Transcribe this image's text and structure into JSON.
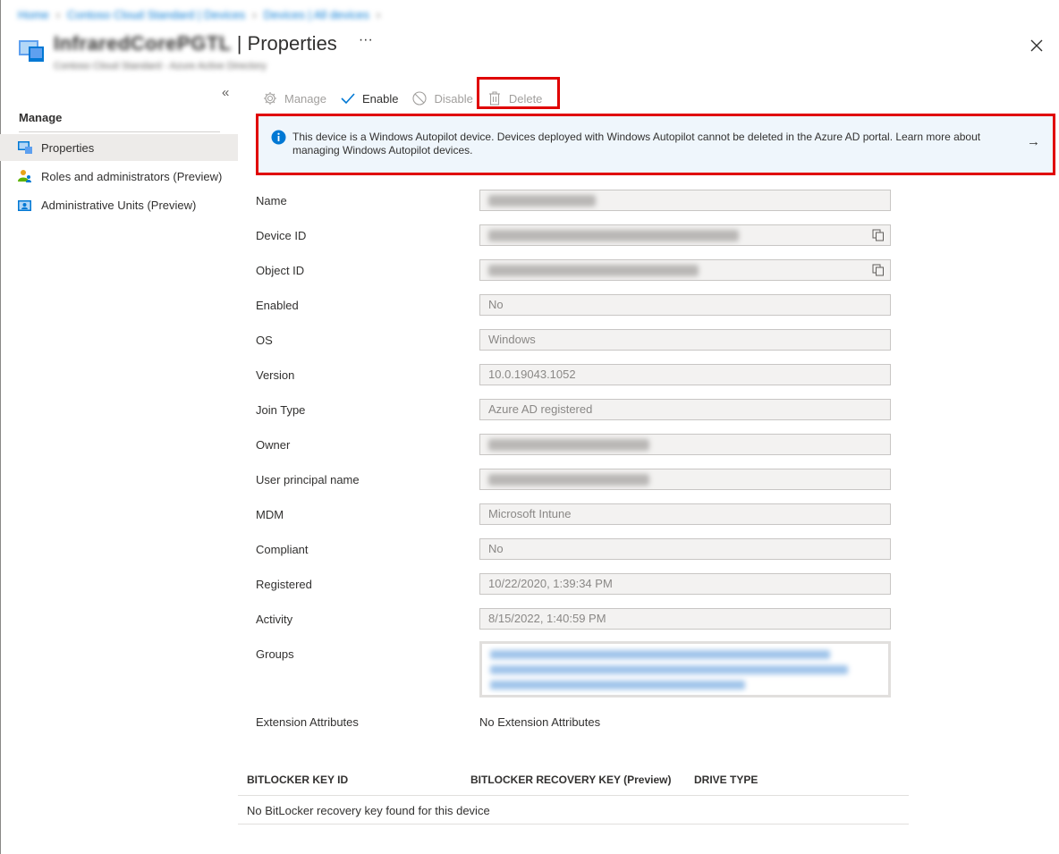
{
  "breadcrumb": {
    "items": [
      "Home",
      "Contoso Cloud Standard | Devices",
      "Devices | All devices"
    ]
  },
  "header": {
    "device_name": "InfraredCorePGTL",
    "title_suffix": "| Properties",
    "more_label": "···",
    "subtitle": "Contoso Cloud Standard - Azure Active Directory"
  },
  "nav": {
    "collapse_label": "«",
    "section": "Manage",
    "items": [
      {
        "label": "Properties",
        "icon": "device-icon",
        "active": true
      },
      {
        "label": "Roles and administrators (Preview)",
        "icon": "people-icon",
        "active": false
      },
      {
        "label": "Administrative Units (Preview)",
        "icon": "admin-units-icon",
        "active": false
      }
    ]
  },
  "toolbar": {
    "manage": "Manage",
    "enable": "Enable",
    "disable": "Disable",
    "delete": "Delete"
  },
  "info_bar": {
    "text": "This device is a Windows Autopilot device. Devices deployed with Windows Autopilot cannot be deleted in the Azure AD portal. Learn more about managing Windows Autopilot devices.",
    "arrow": "→"
  },
  "properties": {
    "name_label": "Name",
    "device_id_label": "Device ID",
    "object_id_label": "Object ID",
    "enabled_label": "Enabled",
    "enabled_value": "No",
    "os_label": "OS",
    "os_value": "Windows",
    "version_label": "Version",
    "version_value": "10.0.19043.1052",
    "join_type_label": "Join Type",
    "join_type_value": "Azure AD registered",
    "owner_label": "Owner",
    "upn_label": "User principal name",
    "mdm_label": "MDM",
    "mdm_value": "Microsoft Intune",
    "compliant_label": "Compliant",
    "compliant_value": "No",
    "registered_label": "Registered",
    "registered_value": "10/22/2020, 1:39:34 PM",
    "activity_label": "Activity",
    "activity_value": "8/15/2022, 1:40:59 PM",
    "groups_label": "Groups",
    "extension_label": "Extension Attributes",
    "extension_value": "No Extension Attributes"
  },
  "bitlocker": {
    "columns": [
      "BITLOCKER KEY ID",
      "BITLOCKER RECOVERY KEY (Preview)",
      "DRIVE TYPE"
    ],
    "empty_text": "No BitLocker recovery key found for this device"
  },
  "colors": {
    "accent": "#0078d4",
    "highlight": "#e00000",
    "info_bg": "#eff6fc"
  }
}
